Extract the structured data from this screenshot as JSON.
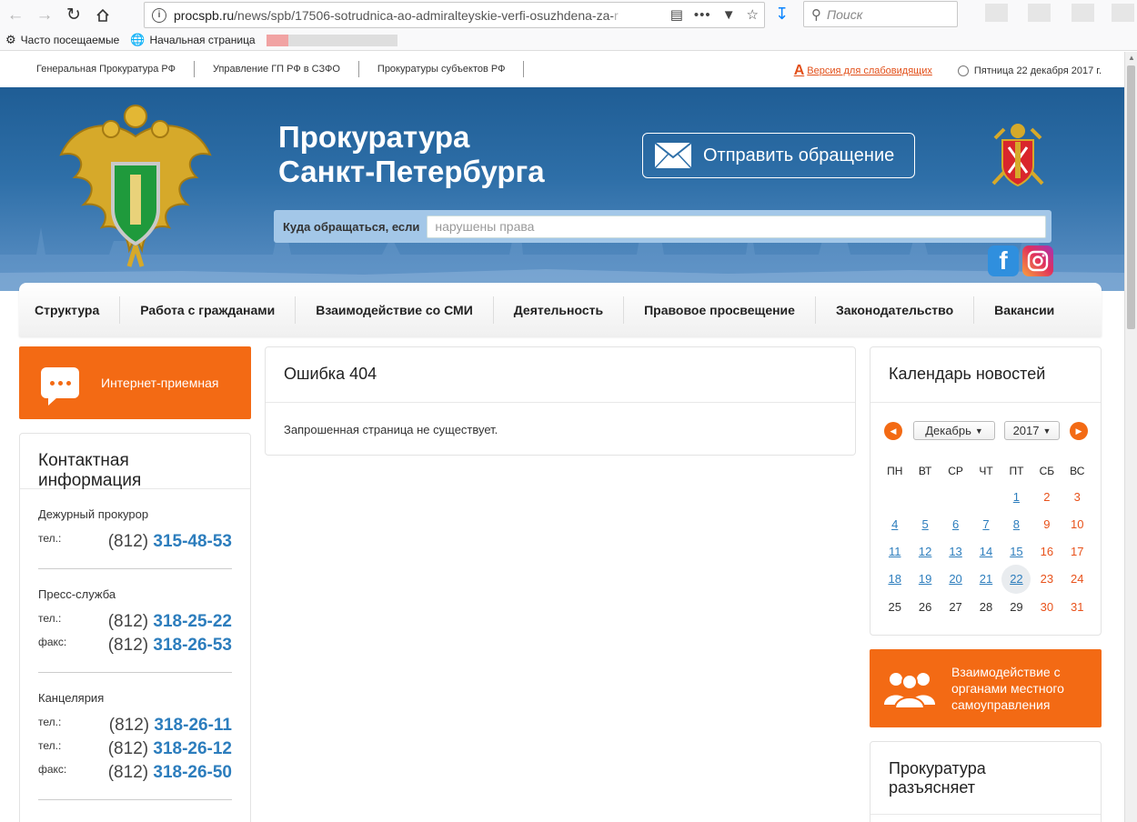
{
  "browser": {
    "url_host": "procspb.ru",
    "url_path": "/news/spb/17506-sotrudnica-ao-admiralteyskie-verfi-osuzhdena-za-",
    "url_faded": "r",
    "search_placeholder": "Поиск",
    "icons": {
      "back": "back-arrow-icon",
      "forward": "forward-arrow-icon",
      "reload": "reload-icon",
      "home": "home-icon"
    },
    "bookmarks": [
      {
        "label": "Часто посещаемые",
        "icon": "gear-icon"
      },
      {
        "label": "Начальная страница",
        "icon": "globe-icon"
      }
    ]
  },
  "utility": {
    "links": [
      "Генеральная Прокуратура РФ",
      "Управление ГП РФ в СЗФО",
      "Прокуратуры субъектов РФ"
    ],
    "vision_label": "Версия для слабовидящих",
    "date": "Пятница 22 декабря 2017 г."
  },
  "header": {
    "title_line1": "Прокуратура",
    "title_line2": "Санкт-Петербурга",
    "send_button": "Отправить обращение",
    "query_label": "Куда обращаться, если",
    "query_placeholder": "нарушены права",
    "colors": {
      "banner": "#2e6fa8",
      "accent": "#f36a14",
      "link": "#2c7dbd"
    }
  },
  "nav": [
    "Структура",
    "Работа с гражданами",
    "Взаимодействие со СМИ",
    "Деятельность",
    "Правовое просвещение",
    "Законодательство",
    "Вакансии"
  ],
  "left": {
    "reception_label": "Интернет-приемная",
    "contacts_title": "Контактная информация",
    "groups": [
      {
        "title": "Дежурный прокурор",
        "rows": [
          {
            "k": "тел.:",
            "code": "(812)",
            "num": "315-48-53"
          }
        ]
      },
      {
        "title": "Пресс-служба",
        "rows": [
          {
            "k": "тел.:",
            "code": "(812)",
            "num": "318-25-22"
          },
          {
            "k": "факс:",
            "code": "(812)",
            "num": "318-26-53"
          }
        ]
      },
      {
        "title": "Канцелярия",
        "rows": [
          {
            "k": "тел.:",
            "code": "(812)",
            "num": "318-26-11"
          },
          {
            "k": "тел.:",
            "code": "(812)",
            "num": "318-26-12"
          },
          {
            "k": "факс:",
            "code": "(812)",
            "num": "318-26-50"
          }
        ]
      }
    ]
  },
  "main": {
    "error_title": "Ошибка 404",
    "error_text": "Запрошенная страница не существует."
  },
  "right": {
    "calendar_title": "Календарь новостей",
    "month": "Декабрь",
    "year": "2017",
    "weekdays": [
      "ПН",
      "ВТ",
      "СР",
      "ЧТ",
      "ПТ",
      "СБ",
      "ВС"
    ],
    "weeks": [
      [
        "",
        "",
        "",
        "",
        "1",
        "2",
        "3"
      ],
      [
        "4",
        "5",
        "6",
        "7",
        "8",
        "9",
        "10"
      ],
      [
        "11",
        "12",
        "13",
        "14",
        "15",
        "16",
        "17"
      ],
      [
        "18",
        "19",
        "20",
        "21",
        "22",
        "23",
        "24"
      ],
      [
        "25",
        "26",
        "27",
        "28",
        "29",
        "30",
        "31"
      ]
    ],
    "linked_days": [
      "1",
      "4",
      "5",
      "6",
      "7",
      "8",
      "11",
      "12",
      "13",
      "14",
      "15",
      "18",
      "19",
      "20",
      "21",
      "22"
    ],
    "today": "22",
    "municipal_label_1": "Взаимодействие с",
    "municipal_label_2": "органами местного",
    "municipal_label_3": "самоуправления",
    "explains_title_1": "Прокуратура",
    "explains_title_2": "разъясняет"
  }
}
